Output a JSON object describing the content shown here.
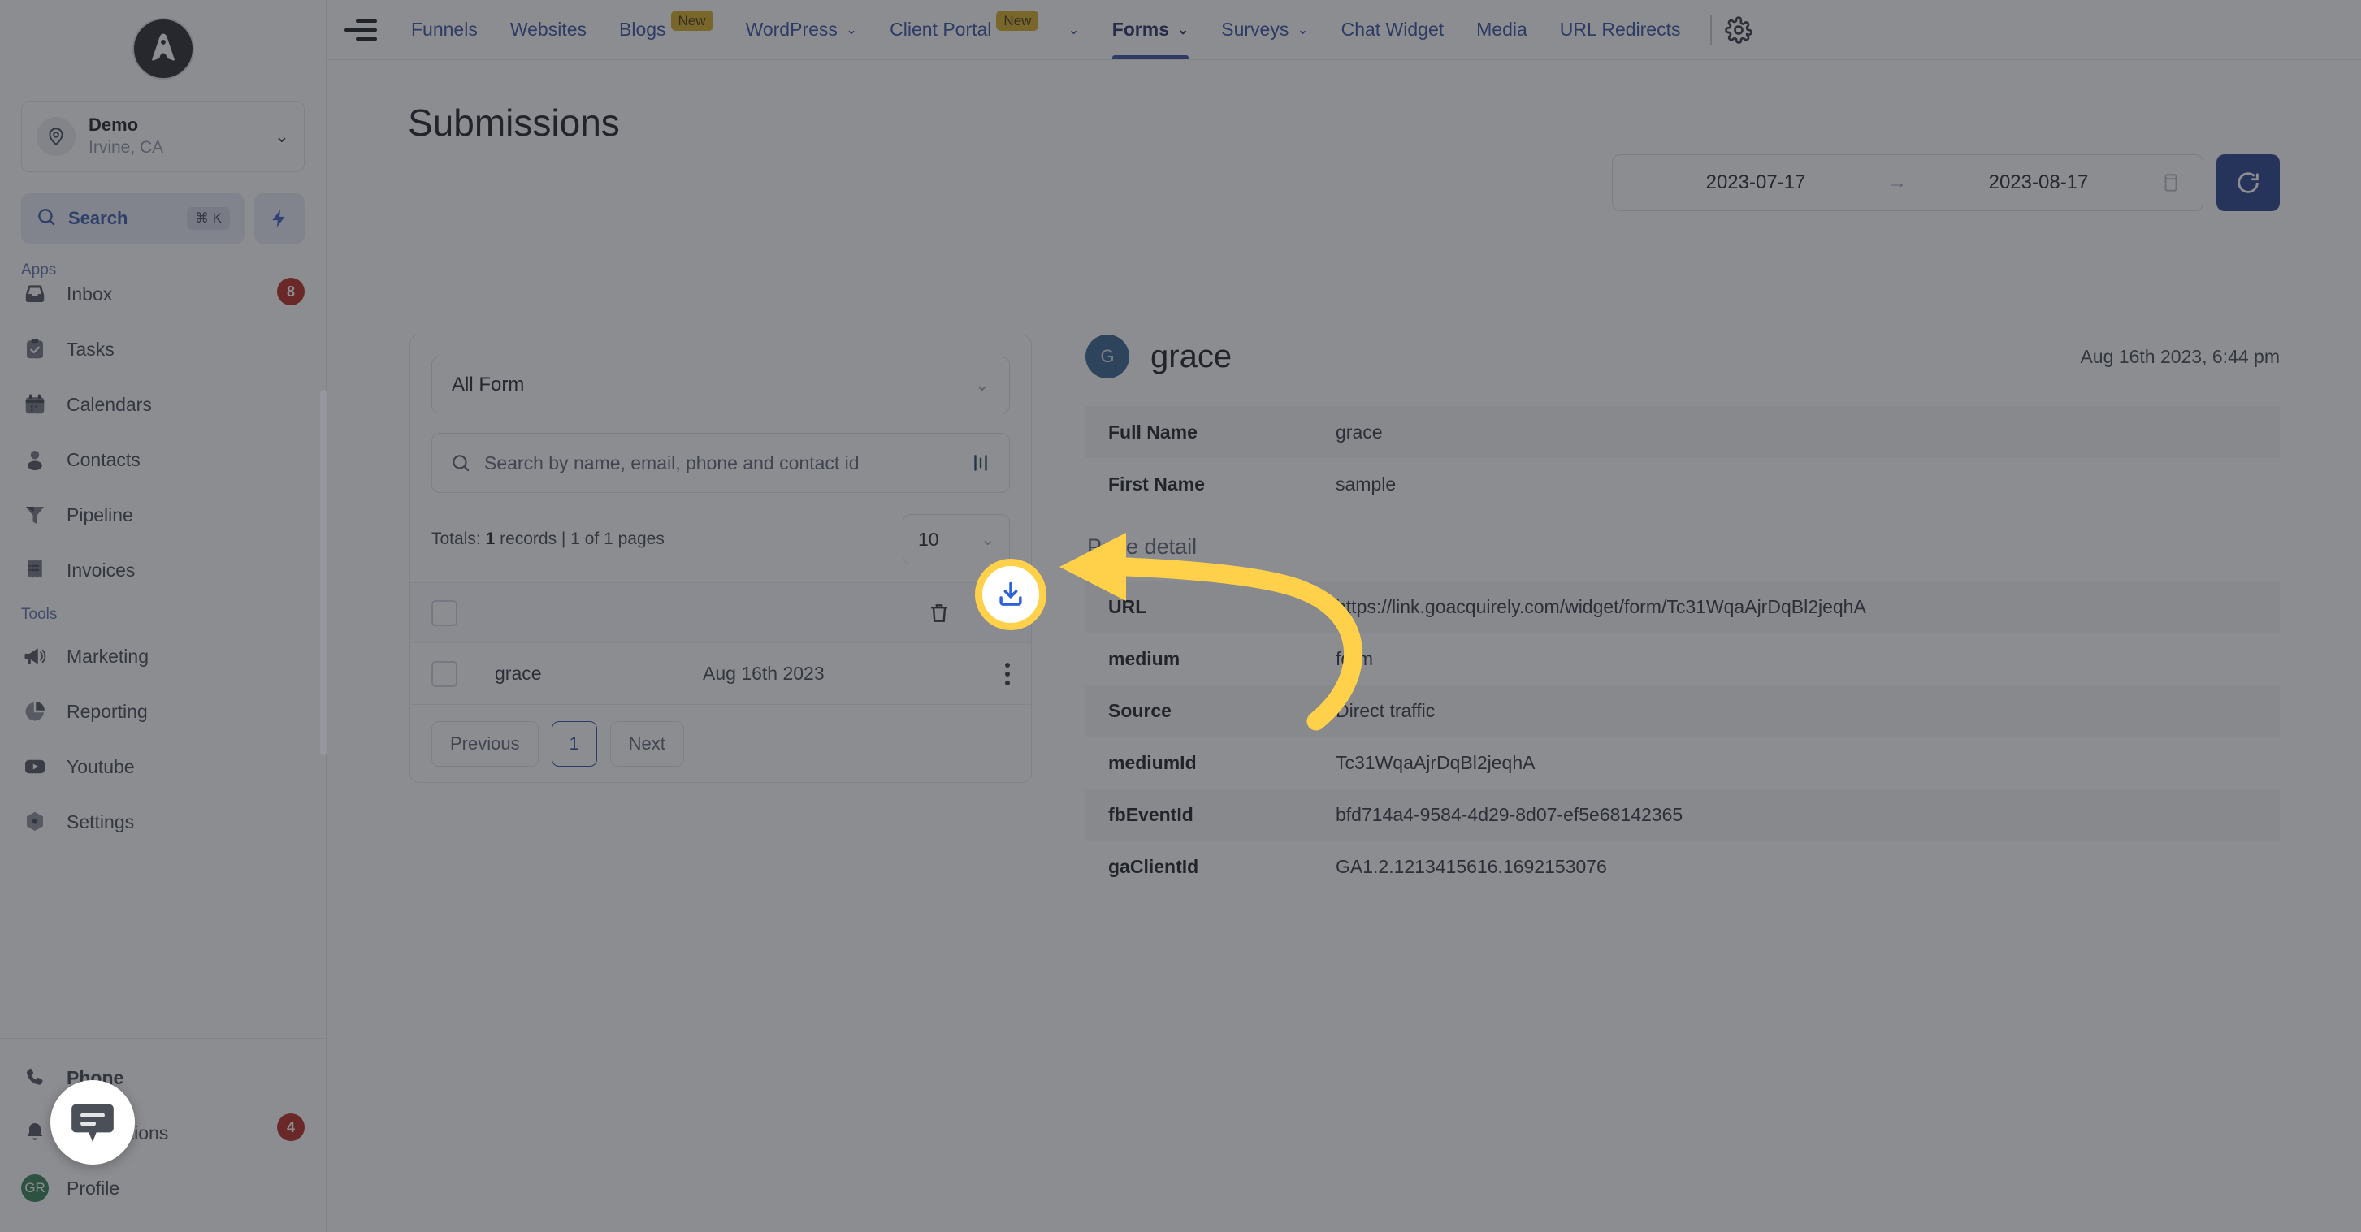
{
  "sidebar": {
    "logo_name": "brand-logo",
    "location": {
      "name": "Demo",
      "sub": "Irvine, CA"
    },
    "search": {
      "label": "Search",
      "shortcut": "⌘ K"
    },
    "group_apps": "Apps",
    "group_tools": "Tools",
    "apps": [
      {
        "label": "Inbox",
        "icon": "inbox-icon",
        "badge": "8"
      },
      {
        "label": "Tasks",
        "icon": "tasks-icon",
        "badge": ""
      },
      {
        "label": "Calendars",
        "icon": "calendar-icon",
        "badge": ""
      },
      {
        "label": "Contacts",
        "icon": "contacts-icon",
        "badge": ""
      },
      {
        "label": "Pipeline",
        "icon": "funnel-icon",
        "badge": ""
      },
      {
        "label": "Invoices",
        "icon": "invoice-icon",
        "badge": ""
      }
    ],
    "tools": [
      {
        "label": "Marketing",
        "icon": "megaphone-icon",
        "badge": ""
      },
      {
        "label": "Reporting",
        "icon": "pie-chart-icon",
        "badge": ""
      },
      {
        "label": "Youtube",
        "icon": "youtube-icon",
        "badge": ""
      },
      {
        "label": "Settings",
        "icon": "settings-icon",
        "badge": ""
      }
    ],
    "footer": [
      {
        "label": "Phone",
        "icon": "phone-icon",
        "badge": ""
      },
      {
        "label": "Notifications",
        "icon": "bell-icon",
        "badge": "4"
      },
      {
        "label": "Profile",
        "icon": "profile-icon",
        "badge": ""
      }
    ],
    "profile_initials": "GR"
  },
  "topnav": {
    "items": [
      {
        "label": "Funnels",
        "tag": "",
        "chevron": false,
        "active": false
      },
      {
        "label": "Websites",
        "tag": "",
        "chevron": false,
        "active": false
      },
      {
        "label": "Blogs",
        "tag": "New",
        "chevron": false,
        "active": false
      },
      {
        "label": "WordPress",
        "tag": "",
        "chevron": true,
        "active": false
      },
      {
        "label": "Client Portal",
        "tag": "New",
        "chevron": true,
        "active": false
      },
      {
        "label": "Forms",
        "tag": "",
        "chevron": true,
        "active": true
      },
      {
        "label": "Surveys",
        "tag": "",
        "chevron": true,
        "active": false
      },
      {
        "label": "Chat Widget",
        "tag": "",
        "chevron": false,
        "active": false
      },
      {
        "label": "Media",
        "tag": "",
        "chevron": false,
        "active": false
      },
      {
        "label": "URL Redirects",
        "tag": "",
        "chevron": false,
        "active": false
      }
    ],
    "settings_icon": "gear-icon"
  },
  "page": {
    "title": "Submissions",
    "date_range": {
      "start": "2023-07-17",
      "end": "2023-08-17",
      "separator": "→"
    },
    "refresh_icon": "refresh-icon",
    "accent_color": "#1e3a8a"
  },
  "submissions_panel": {
    "form_filter": "All Form",
    "search_placeholder": "Search by name, email, phone and contact id",
    "totals_prefix": "Totals:",
    "totals_count": "1",
    "totals_suffix": "records | 1 of 1 pages",
    "per_page": "10",
    "rows": [
      {
        "name": "grace",
        "date": "Aug 16th 2023"
      }
    ],
    "pagination": {
      "previous": "Previous",
      "current": "1",
      "next": "Next"
    }
  },
  "detail": {
    "initial": "G",
    "name": "grace",
    "timestamp": "Aug 16th 2023, 6:44 pm",
    "fields": [
      {
        "key": "Full Name",
        "value": "grace"
      },
      {
        "key": "First Name",
        "value": "sample"
      }
    ],
    "section_label": "Page detail",
    "page_fields": [
      {
        "key": "URL",
        "value": "https://link.goacquirely.com/widget/form/Tc31WqaAjrDqBl2jeqhA"
      },
      {
        "key": "medium",
        "value": "form"
      },
      {
        "key": "Source",
        "value": "Direct traffic"
      },
      {
        "key": "mediumId",
        "value": "Tc31WqaAjrDqBl2jeqhA"
      },
      {
        "key": "fbEventId",
        "value": "bfd714a4-9584-4d29-8d07-ef5e68142365"
      },
      {
        "key": "gaClientId",
        "value": "GA1.2.1213415616.1692153076"
      }
    ]
  },
  "annotation": {
    "highlight_icon": "download-icon",
    "highlight_color": "#ffd04a",
    "icon_color": "#2f62d8"
  }
}
